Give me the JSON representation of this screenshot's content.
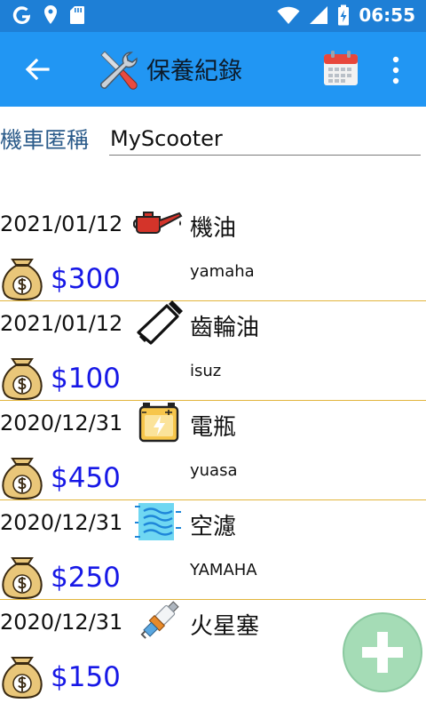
{
  "status_bar": {
    "time": "06:55",
    "icons": [
      "google-icon",
      "location-icon",
      "sd-card-icon",
      "wifi-icon",
      "signal-icon",
      "battery-charging-icon"
    ]
  },
  "app_bar": {
    "title": "保養紀錄",
    "back_icon": "arrow-back-icon",
    "logo_icon": "tools-icon",
    "calendar_icon": "calendar-icon",
    "more_icon": "more-vertical-icon",
    "color": "#2196f3"
  },
  "scooter": {
    "label": "機車匿稱",
    "value": "MyScooter"
  },
  "records": [
    {
      "date": "2021/01/12",
      "item": "機油",
      "icon": "oil-can-icon",
      "price": "$300",
      "brand": "yamaha"
    },
    {
      "date": "2021/01/12",
      "item": "齒輪油",
      "icon": "gear-oil-tube-icon",
      "price": "$100",
      "brand": "isuz"
    },
    {
      "date": "2020/12/31",
      "item": "電瓶",
      "icon": "battery-icon",
      "price": "$450",
      "brand": "yuasa"
    },
    {
      "date": "2020/12/31",
      "item": "空濾",
      "icon": "air-filter-icon",
      "price": "$250",
      "brand": "YAMAHA"
    },
    {
      "date": "2020/12/31",
      "item": "火星塞",
      "icon": "spark-plug-icon",
      "price": "$150",
      "brand": ""
    }
  ],
  "colors": {
    "price": "#1718e6",
    "divider": "#e2b53d",
    "fab": "#a5dcb6",
    "label": "#2b5b8a"
  },
  "fab": {
    "icon": "plus-icon"
  }
}
